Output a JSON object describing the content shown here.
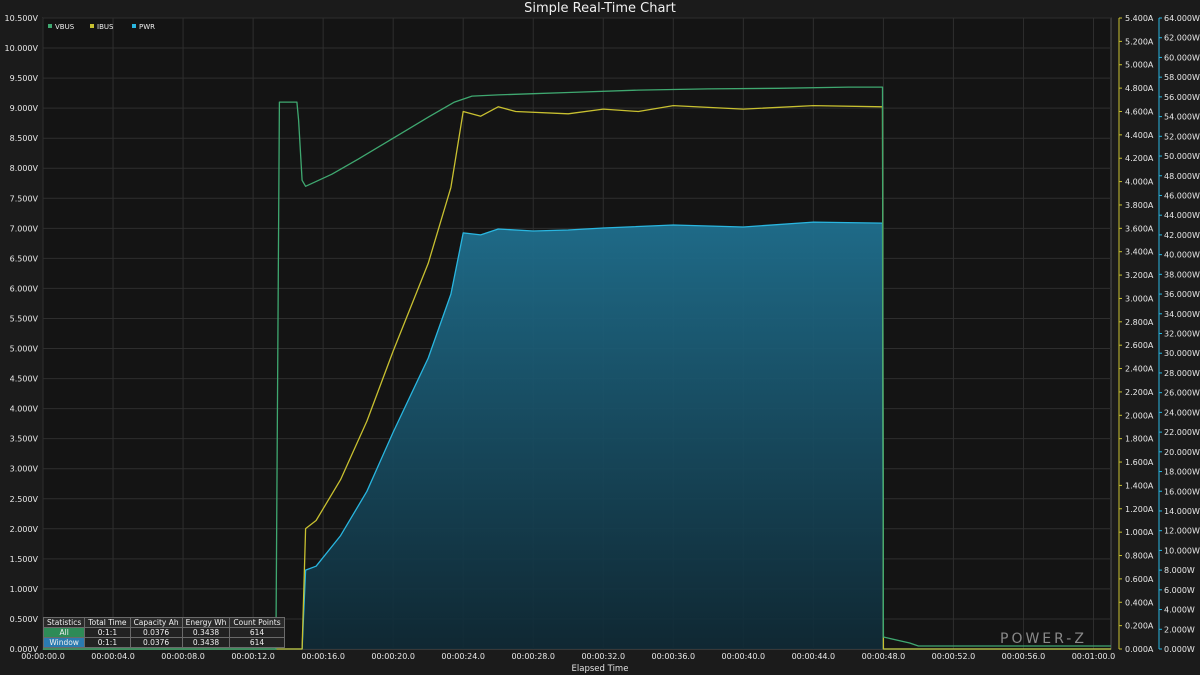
{
  "chart_data": {
    "type": "line",
    "title": "Simple Real-Time Chart",
    "xlabel": "Elapsed Time",
    "x_range_seconds": [
      0,
      61
    ],
    "x_tick_labels": [
      "00:00:00.0",
      "00:00:04.0",
      "00:00:08.0",
      "00:00:12.0",
      "00:00:16.0",
      "00:00:20.0",
      "00:00:24.0",
      "00:00:28.0",
      "00:00:32.0",
      "00:00:36.0",
      "00:00:40.0",
      "00:00:44.0",
      "00:00:48.0",
      "00:00:52.0",
      "00:00:56.0",
      "00:01:00.0"
    ],
    "y_left": {
      "unit": "V",
      "range": [
        0,
        10.5
      ],
      "tick_labels": [
        "0.000V",
        "0.500V",
        "1.000V",
        "1.500V",
        "2.000V",
        "2.500V",
        "3.000V",
        "3.500V",
        "4.000V",
        "4.500V",
        "5.000V",
        "5.500V",
        "6.000V",
        "6.500V",
        "7.000V",
        "7.500V",
        "8.000V",
        "8.500V",
        "9.000V",
        "9.500V",
        "10.000V",
        "10.500V"
      ]
    },
    "y_right_1": {
      "unit": "A",
      "range": [
        0,
        5.4
      ],
      "tick_labels": [
        "0.000A",
        "0.200A",
        "0.400A",
        "0.600A",
        "0.800A",
        "1.000A",
        "1.200A",
        "1.400A",
        "1.600A",
        "1.800A",
        "2.000A",
        "2.200A",
        "2.400A",
        "2.600A",
        "2.800A",
        "3.000A",
        "3.200A",
        "3.400A",
        "3.600A",
        "3.800A",
        "4.000A",
        "4.200A",
        "4.400A",
        "4.600A",
        "4.800A",
        "5.000A",
        "5.200A",
        "5.400A"
      ]
    },
    "y_right_2": {
      "unit": "W",
      "range": [
        0,
        64
      ],
      "tick_labels": [
        "0.000W",
        "2.000W",
        "4.000W",
        "6.000W",
        "8.000W",
        "10.000W",
        "12.000W",
        "14.000W",
        "16.000W",
        "18.000W",
        "20.000W",
        "22.000W",
        "24.000W",
        "26.000W",
        "28.000W",
        "30.000W",
        "32.000W",
        "34.000W",
        "36.000W",
        "38.000W",
        "40.000W",
        "42.000W",
        "44.000W",
        "46.000W",
        "48.000W",
        "50.000W",
        "52.000W",
        "54.000W",
        "56.000W",
        "58.000W",
        "60.000W",
        "62.000W",
        "64.000W"
      ]
    },
    "grid": true,
    "legend_position": "top-left",
    "series": [
      {
        "name": "VBUS",
        "axis": "y_left",
        "color": "#3fa870",
        "x": [
          0,
          13.3,
          13.5,
          14.5,
          14.6,
          14.8,
          15.0,
          16.5,
          18.0,
          20.0,
          22.0,
          23.5,
          24.5,
          26.0,
          28.0,
          30.0,
          34.0,
          38.0,
          42.0,
          46.0,
          47.95,
          48.0,
          49.5,
          50.0,
          61.0
        ],
        "y": [
          0.0,
          0.0,
          9.1,
          9.1,
          8.8,
          7.8,
          7.7,
          7.9,
          8.15,
          8.5,
          8.85,
          9.1,
          9.2,
          9.22,
          9.24,
          9.26,
          9.3,
          9.32,
          9.33,
          9.35,
          9.35,
          0.2,
          0.1,
          0.05,
          0.05
        ]
      },
      {
        "name": "IBUS",
        "axis": "y_right_1",
        "color": "#c8c030",
        "x": [
          0,
          14.8,
          15.0,
          15.6,
          17.0,
          18.5,
          20.0,
          22.0,
          23.3,
          24.0,
          25.0,
          26.0,
          27.0,
          30.0,
          32.0,
          34.0,
          36.0,
          40.0,
          44.0,
          47.95,
          48.0,
          61.0
        ],
        "y": [
          0.0,
          0.0,
          1.03,
          1.1,
          1.45,
          1.95,
          2.55,
          3.3,
          3.95,
          4.6,
          4.56,
          4.64,
          4.6,
          4.58,
          4.62,
          4.6,
          4.65,
          4.62,
          4.65,
          4.64,
          0.0,
          0.0
        ]
      },
      {
        "name": "PWR",
        "axis": "y_right_2",
        "color": "#29b6e0",
        "filled": true,
        "x": [
          0,
          14.8,
          15.0,
          15.6,
          17.0,
          18.5,
          20.0,
          22.0,
          23.3,
          24.0,
          25.0,
          26.0,
          28.0,
          30.0,
          32.0,
          36.0,
          40.0,
          44.0,
          47.95,
          48.0,
          61.0
        ],
        "y": [
          0.0,
          0.0,
          8.0,
          8.4,
          11.5,
          16.0,
          22.0,
          29.5,
          36.0,
          42.2,
          42.0,
          42.6,
          42.4,
          42.5,
          42.7,
          43.0,
          42.8,
          43.3,
          43.2,
          0.0,
          0.0
        ]
      }
    ],
    "statistics_table": {
      "headers": [
        "Statistics",
        "Total Time",
        "Capacity Ah",
        "Energy Wh",
        "Count Points"
      ],
      "rows": [
        [
          "All",
          "0:1:1",
          "0.0376",
          "0.3438",
          "614"
        ],
        [
          "Window",
          "0:1:1",
          "0.0376",
          "0.3438",
          "614"
        ]
      ]
    },
    "watermark": "POWER-Z"
  }
}
